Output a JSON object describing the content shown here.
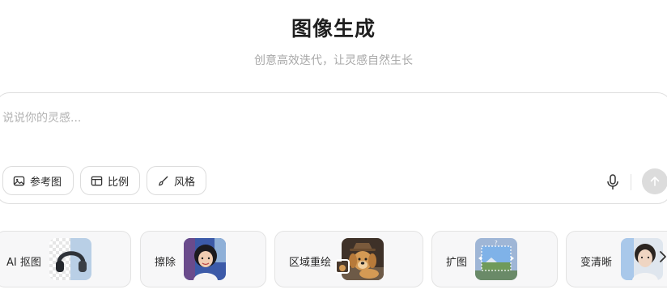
{
  "header": {
    "title": "图像生成",
    "subtitle": "创意高效迭代，让灵感自然生长"
  },
  "prompt": {
    "placeholder": "说说你的灵感..."
  },
  "options": {
    "reference": "参考图",
    "ratio": "比例",
    "style": "风格"
  },
  "tools": [
    {
      "label": "AI 抠图",
      "icon": "headphones-thumbnail"
    },
    {
      "label": "擦除",
      "icon": "girl-portrait-thumbnail"
    },
    {
      "label": "区域重绘",
      "icon": "dog-thumbnail"
    },
    {
      "label": "扩图",
      "icon": "landscape-thumbnail"
    },
    {
      "label": "变清晰",
      "icon": "man-portrait-thumbnail"
    }
  ],
  "colors": {
    "send_button": "#dcdcdc",
    "card_bg": "#f7f7f8",
    "subtitle": "#a8a8a8"
  }
}
